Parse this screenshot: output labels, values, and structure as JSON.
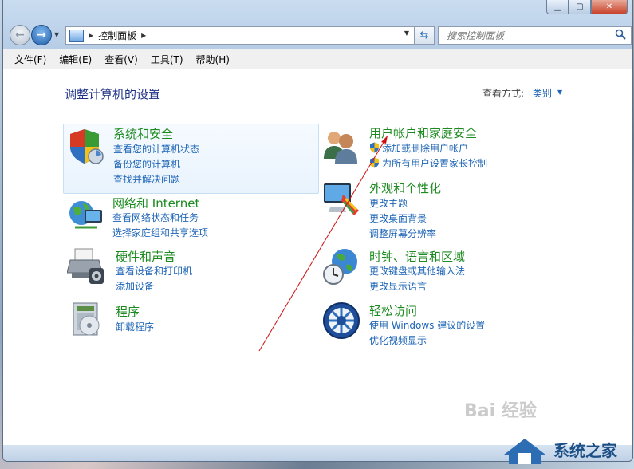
{
  "window": {
    "caption_minimize": "▁",
    "caption_maximize": "▢",
    "caption_close": "✕"
  },
  "address": {
    "breadcrumb": "控制面板",
    "search_placeholder": "搜索控制面板"
  },
  "menu": {
    "items": [
      "文件(F)",
      "编辑(E)",
      "查看(V)",
      "工具(T)",
      "帮助(H)"
    ]
  },
  "content": {
    "page_title": "调整计算机的设置",
    "view_by_label": "查看方式:",
    "view_by_value": "类别"
  },
  "categories": {
    "system_security": {
      "title": "系统和安全",
      "links": [
        "查看您的计算机状态",
        "备份您的计算机",
        "查找并解决问题"
      ]
    },
    "network": {
      "title": "网络和 Internet",
      "links": [
        "查看网络状态和任务",
        "选择家庭组和共享选项"
      ]
    },
    "hardware": {
      "title": "硬件和声音",
      "links": [
        "查看设备和打印机",
        "添加设备"
      ]
    },
    "programs": {
      "title": "程序",
      "links": [
        "卸载程序"
      ]
    },
    "user_accounts": {
      "title": "用户帐户和家庭安全",
      "links": [
        "添加或删除用户帐户",
        "为所有用户设置家长控制"
      ]
    },
    "appearance": {
      "title": "外观和个性化",
      "links": [
        "更改主题",
        "更改桌面背景",
        "调整屏幕分辨率"
      ]
    },
    "clock": {
      "title": "时钟、语言和区域",
      "links": [
        "更改键盘或其他输入法",
        "更改显示语言"
      ]
    },
    "ease": {
      "title": "轻松访问",
      "links": [
        "使用 Windows 建议的设置",
        "优化视频显示"
      ]
    }
  },
  "watermarks": {
    "baidu": "Bai 经验",
    "site": "系统之家"
  },
  "icons": [
    "shield-icon",
    "users-icon",
    "globe-network-icon",
    "printer-icon",
    "programs-icon",
    "monitor-palette-icon",
    "globe-clock-icon",
    "ease-of-access-icon",
    "search-icon",
    "refresh-icon"
  ],
  "colors": {
    "category_title": "#1b8a1f",
    "link": "#1e65b6",
    "page_title": "#1e3287",
    "annotation_arrow": "#d01010"
  }
}
